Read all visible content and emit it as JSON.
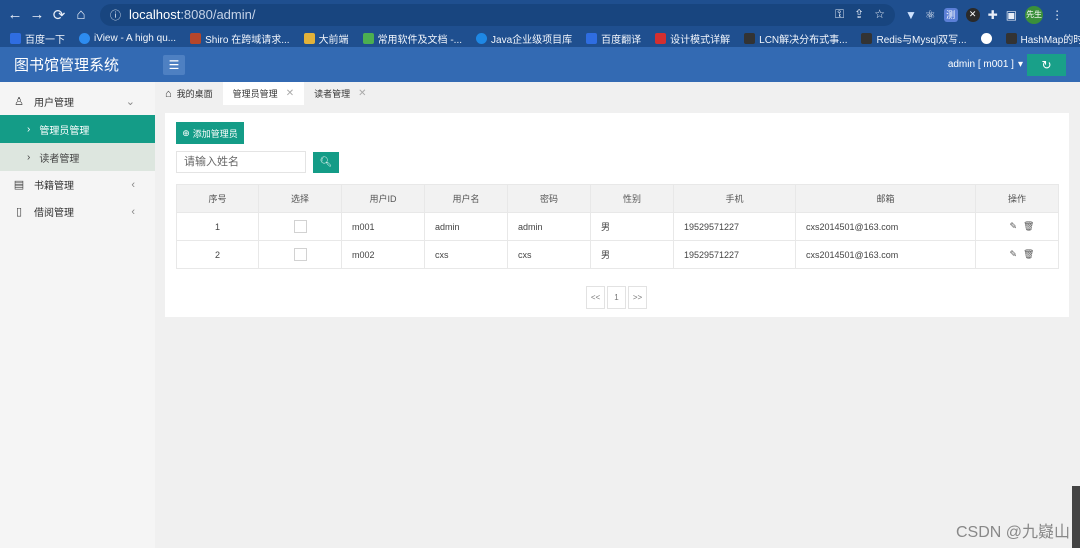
{
  "browser": {
    "url_host": "localhost",
    "url_path": ":8080/admin/",
    "profile_label": "先生",
    "bookmarks": [
      {
        "label": "百度一下",
        "color": "#2f6de1"
      },
      {
        "label": "iView - A high qu...",
        "color": "#2d8cf0"
      },
      {
        "label": "Shiro 在跨域请求...",
        "color": "#b5462a"
      },
      {
        "label": "大前端",
        "color": "#e2b23a"
      },
      {
        "label": "常用软件及文档 -...",
        "color": "#4caf50"
      },
      {
        "label": "Java企业级项目库",
        "color": "#1e88e5"
      },
      {
        "label": "百度翻译",
        "color": "#2f6de1"
      },
      {
        "label": "设计模式详解",
        "color": "#d32f2f"
      },
      {
        "label": "LCN解决分布式事...",
        "color": "#333333"
      },
      {
        "label": "Redis与Mysql双写...",
        "color": "#333333"
      },
      {
        "label": "",
        "color": "#ffffff"
      },
      {
        "label": "HashMap的时间复...",
        "color": "#333333"
      }
    ]
  },
  "header": {
    "app_title": "图书馆管理系统",
    "user_label": "admin [ m001 ]",
    "accent": "#149c87"
  },
  "sidebar": {
    "items": [
      {
        "label": "用户管理",
        "icon": "user-icon"
      },
      {
        "label": "管理员管理"
      },
      {
        "label": "读者管理"
      },
      {
        "label": "书籍管理",
        "icon": "book-icon"
      },
      {
        "label": "借阅管理",
        "icon": "clipboard-icon"
      }
    ]
  },
  "tabs": [
    {
      "label": "我的桌面"
    },
    {
      "label": "管理员管理"
    },
    {
      "label": "读者管理"
    }
  ],
  "main": {
    "add_button": "添加管理员",
    "search_placeholder": "请输入姓名",
    "columns": [
      "序号",
      "选择",
      "用户ID",
      "用户名",
      "密码",
      "性别",
      "手机",
      "邮箱",
      "操作"
    ],
    "rows": [
      {
        "index": "1",
        "user_id": "m001",
        "username": "admin",
        "password": "admin",
        "gender": "男",
        "phone": "19529571227",
        "email": "cxs2014501@163.com"
      },
      {
        "index": "2",
        "user_id": "m002",
        "username": "cxs",
        "password": "cxs",
        "gender": "男",
        "phone": "19529571227",
        "email": "cxs2014501@163.com"
      }
    ],
    "pager": {
      "prev": "<<",
      "page": "1",
      "next": ">>"
    }
  },
  "watermark": "CSDN @九嶷山"
}
